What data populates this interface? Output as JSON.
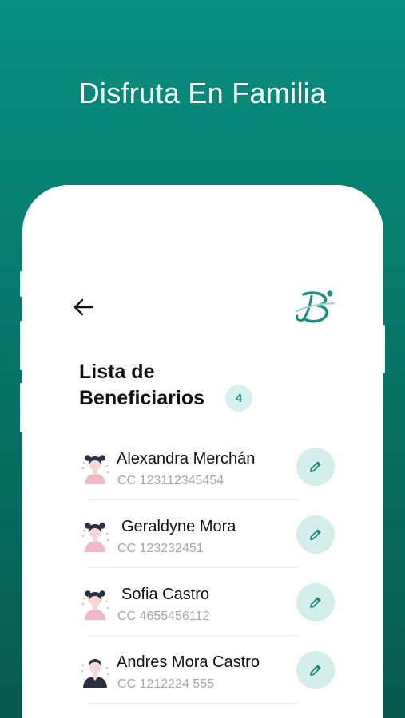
{
  "headline": "Disfruta En Familia",
  "screen": {
    "back_icon": "arrow-left-icon",
    "logo_icon": "brand-b-logo",
    "title_line1": "Lista de",
    "title_line2": "Beneficiarios",
    "count": "4",
    "beneficiaries": [
      {
        "name": "Alexandra Merchán",
        "document": "CC 123112345454",
        "avatar": "female-avatar-icon"
      },
      {
        "name": "Geraldyne Mora",
        "document": "CC 123232451",
        "avatar": "female-avatar-icon"
      },
      {
        "name": "Sofia Castro",
        "document": "CC 4655456112",
        "avatar": "female-avatar-icon"
      },
      {
        "name": "Andres Mora Castro",
        "document": "CC 1212224 555",
        "avatar": "male-avatar-icon"
      }
    ],
    "edit_icon": "pencil-icon"
  },
  "colors": {
    "background_top": "#07907e",
    "background_bottom": "#065a50",
    "accent": "#18897c",
    "badge_bg": "#d7f1ee",
    "edit_button_bg": "#d3eeeb"
  }
}
